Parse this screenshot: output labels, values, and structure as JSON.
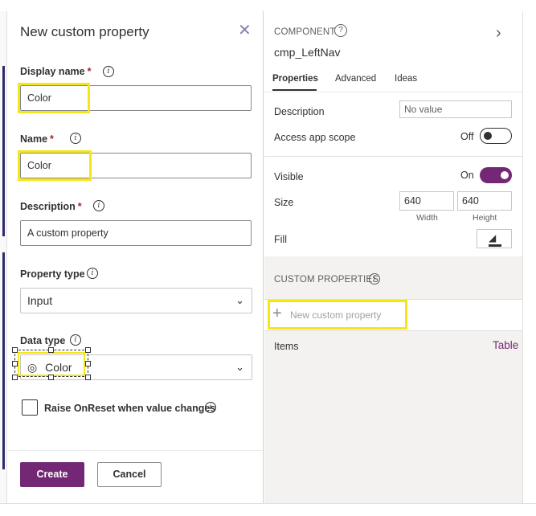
{
  "left_panel": {
    "title": "New custom property",
    "close_icon": "close-icon",
    "display_name": {
      "label": "Display name",
      "required_mark": "*",
      "value": "Color"
    },
    "name": {
      "label": "Name",
      "required_mark": "*",
      "value": "Color"
    },
    "description": {
      "label": "Description",
      "required_mark": "*",
      "value": "A custom property"
    },
    "property_type": {
      "label": "Property type",
      "selected": "Input"
    },
    "data_type": {
      "label": "Data type",
      "selected": "Color",
      "icon": "palette-icon"
    },
    "checkbox_label": "Raise OnReset when value changes",
    "create_label": "Create",
    "cancel_label": "Cancel",
    "info_glyph": "i"
  },
  "right_panel": {
    "section_label": "COMPONENT",
    "help_glyph": "?",
    "component_name": "cmp_LeftNav",
    "tabs": [
      {
        "label": "Properties"
      },
      {
        "label": "Advanced"
      },
      {
        "label": "Ideas"
      }
    ],
    "description": {
      "label": "Description",
      "placeholder": "No value"
    },
    "access_scope": {
      "label": "Access app scope",
      "state_text": "Off"
    },
    "visible": {
      "label": "Visible",
      "state_text": "On"
    },
    "size": {
      "label": "Size",
      "width": "640",
      "height": "640",
      "width_caption": "Width",
      "height_caption": "Height"
    },
    "fill": {
      "label": "Fill"
    },
    "custom_properties_title": "CUSTOM PROPERTIES",
    "new_custom_property": "New custom property",
    "items": {
      "label": "Items",
      "value": "Table"
    }
  },
  "colors": {
    "accent": "#742774",
    "highlight": "#f5e61a",
    "required": "#a4262c"
  }
}
